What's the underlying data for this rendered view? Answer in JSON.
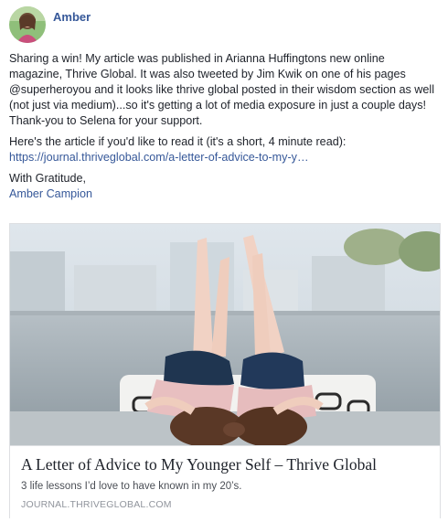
{
  "post": {
    "author": "Amber",
    "paragraph1": "Sharing a win! My article was published in Arianna Huffingtons new online magazine, Thrive Global. It was also tweeted by Jim Kwik on one of his pages @superheroyou and it looks like thrive global posted in their wisdom section as well (not just via medium)...so it's getting a lot of media exposure in just a couple days! Thank-you to Selena for your support.",
    "paragraph2": "Here's the article if you'd like to read it (it's a short, 4 minute read):",
    "link_text": "https://journal.thriveglobal.com/a-letter-of-advice-to-my-y…",
    "closing": "With Gratitude,",
    "signature": "Amber Campion"
  },
  "card": {
    "title": "A Letter of Advice to My Younger Self – Thrive Global",
    "description": "3 life lessons I’d love to have known in my 20’s.",
    "domain": "JOURNAL.THRIVEGLOBAL.COM"
  },
  "colors": {
    "link": "#365899",
    "text": "#1d2129",
    "muted": "#90949c"
  }
}
